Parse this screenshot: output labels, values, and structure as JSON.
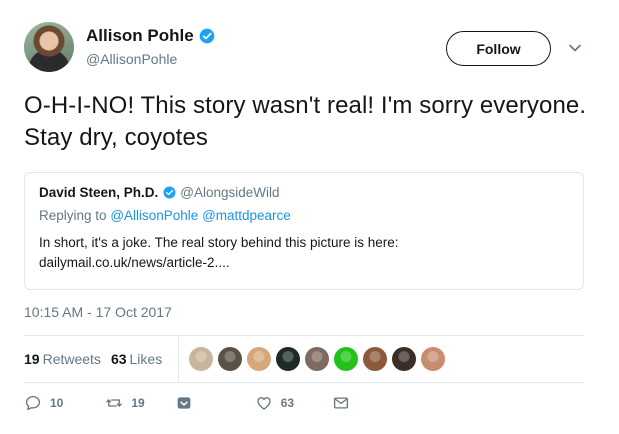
{
  "author": {
    "name": "Allison Pohle",
    "handle": "@AllisonPohle"
  },
  "follow_label": "Follow",
  "tweet_text": "O-H-I-NO! This story wasn't real! I'm sorry everyone. Stay dry, coyotes",
  "quoted": {
    "name": "David Steen, Ph.D.",
    "handle": "@AlongsideWild",
    "replying_prefix": "Replying to",
    "replying_to": "@AllisonPohle @mattdpearce",
    "body_line1": "In short, it's a joke. The real story behind this picture is here:",
    "body_line2": "dailymail.co.uk/news/article-2...."
  },
  "timestamp": "10:15 AM - 17 Oct 2017",
  "stats": {
    "retweets_count": "19",
    "retweets_label": "Retweets",
    "likes_count": "63",
    "likes_label": "Likes"
  },
  "liker_faces": [
    {
      "color": "#c9b59c"
    },
    {
      "color": "#5a5147"
    },
    {
      "color": "#d6a77a"
    },
    {
      "color": "#1d2b24"
    },
    {
      "color": "#7d6a61"
    },
    {
      "color": "#22c21a"
    },
    {
      "color": "#8a5a3a"
    },
    {
      "color": "#3b2e26"
    },
    {
      "color": "#c88c6e"
    }
  ],
  "actions": {
    "reply_count": "10",
    "retweet_count": "19",
    "like_count": "63"
  },
  "colors": {
    "verified": "#1da1f2",
    "link": "#1b95e0",
    "muted": "#657786"
  },
  "icons": [
    "verified-badge-icon",
    "chevron-down-icon",
    "reply-icon",
    "retweet-icon",
    "direct-message-icon",
    "like-icon",
    "envelope-icon"
  ]
}
